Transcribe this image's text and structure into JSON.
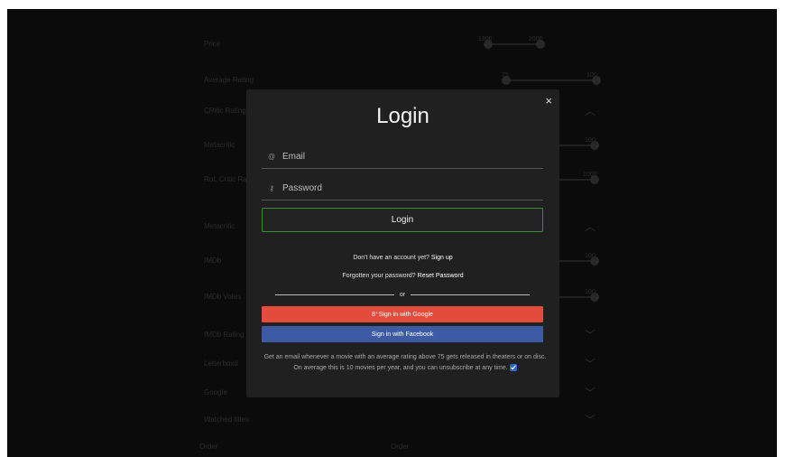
{
  "background": {
    "filters": [
      {
        "label": "Price",
        "kind": "slider",
        "min_label": "1900",
        "max_label": "2000"
      },
      {
        "label": "Average Rating",
        "kind": "slider",
        "min_label": "75",
        "max_label": "100"
      },
      {
        "label": "CRitic Rating",
        "kind": "dropdown"
      },
      {
        "label": "Metacritic",
        "kind": "slider",
        "max_label": "100"
      },
      {
        "label": "Rot. Critic Rating",
        "kind": "slider",
        "max_label": "1000"
      },
      {
        "label": "Metacritic",
        "kind": "dropdown"
      },
      {
        "label": "IMDb",
        "kind": "slider",
        "max_label": "100"
      },
      {
        "label": "IMDb Votes",
        "kind": "slider",
        "max_label": "100"
      },
      {
        "label": "IMDb Rating",
        "kind": "dropdown"
      },
      {
        "label": "Letterboxd",
        "kind": "dropdown"
      },
      {
        "label": "Google",
        "kind": "dropdown"
      },
      {
        "label": "Watched titles",
        "kind": "dropdown"
      }
    ],
    "footer_label": "Order",
    "footer_value": "Order"
  },
  "modal": {
    "close_label": "×",
    "title": "Login",
    "email_placeholder": "Email",
    "password_placeholder": "Password",
    "login_button": "Login",
    "signup_prompt": "Don't have an account yet?",
    "signup_link": "Sign up",
    "forgot_prompt": "Forgotten your password?",
    "reset_link": "Reset Password",
    "or_text": "or",
    "google_button": "Sign in with Google",
    "google_icon_text": "8⁺",
    "facebook_button": "Sign in with Facebook",
    "promo_text": "Get an email whenever a movie with an average rating above 75 gets released in theaters or on disc. On average this is 10 movies per year, and you can unsubscribe at any time.",
    "promo_checked": true
  },
  "colors": {
    "google": "#e34b3b",
    "facebook": "#3d5aa4",
    "login_border": "#3c8c3c"
  }
}
